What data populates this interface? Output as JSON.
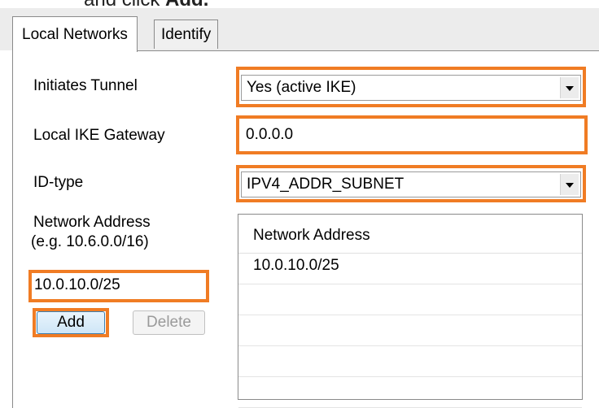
{
  "caption": {
    "prefix": "and click ",
    "bold": "Add."
  },
  "tabs": [
    {
      "label": "Local Networks",
      "active": true
    },
    {
      "label": "Identify",
      "active": false
    }
  ],
  "form": {
    "initiates_tunnel": {
      "label": "Initiates Tunnel",
      "value": "Yes (active IKE)"
    },
    "local_ike_gateway": {
      "label": "Local IKE Gateway",
      "value": "0.0.0.0"
    },
    "id_type": {
      "label": "ID-type",
      "value": "IPV4_ADDR_SUBNET"
    },
    "network_address": {
      "label": "Network Address",
      "hint": "(e.g. 10.6.0.0/16)",
      "value": "10.0.10.0/25"
    },
    "add_label": "Add",
    "delete_label": "Delete"
  },
  "network_list": {
    "column_header": "Network Address",
    "rows": [
      "10.0.10.0/25",
      "",
      "",
      "",
      ""
    ]
  },
  "colors": {
    "highlight": "#f07c24",
    "tab_strip": "#ececec"
  }
}
